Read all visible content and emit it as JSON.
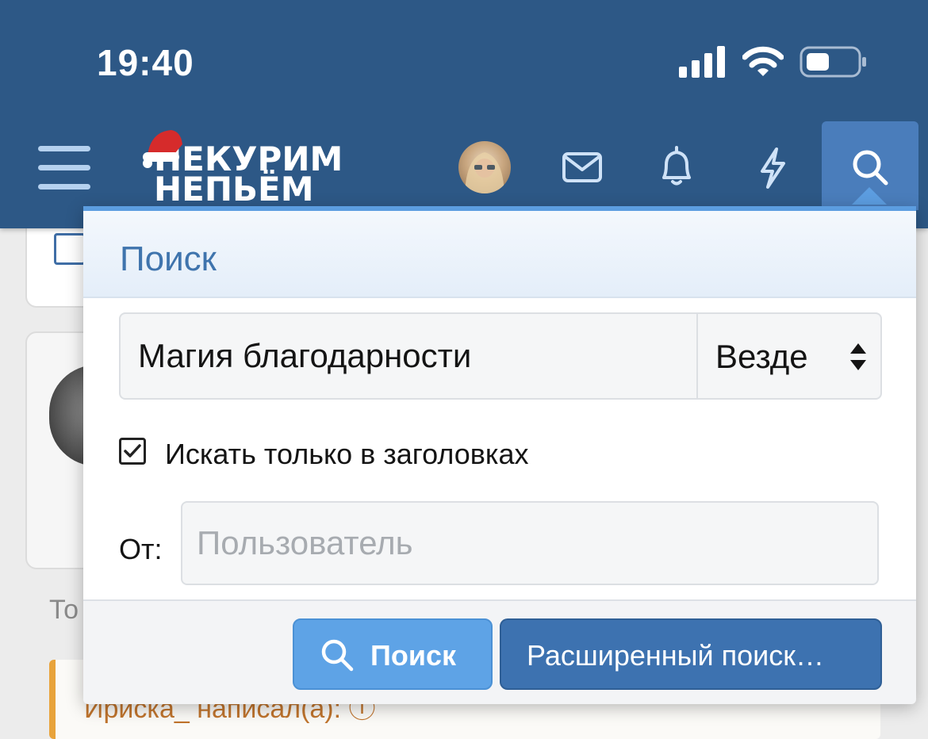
{
  "status_bar": {
    "time": "19:40"
  },
  "header": {
    "logo_line1": "НЕКУРИМ",
    "logo_line2": "НЕПЬЁМ",
    "accent_color": "#2d5886"
  },
  "background": {
    "partial_text": "То",
    "quote_author": "Ириска_ написал(а): ⓘ"
  },
  "search_menu": {
    "title": "Поиск",
    "keyword_value": "Магия благодарности",
    "scope_value": "Везде",
    "titles_only_label": "Искать только в заголовках",
    "titles_only_checked": true,
    "from_label": "От:",
    "user_placeholder": "Пользователь",
    "search_button": "Поиск",
    "advanced_button": "Расширенный поиск…"
  }
}
